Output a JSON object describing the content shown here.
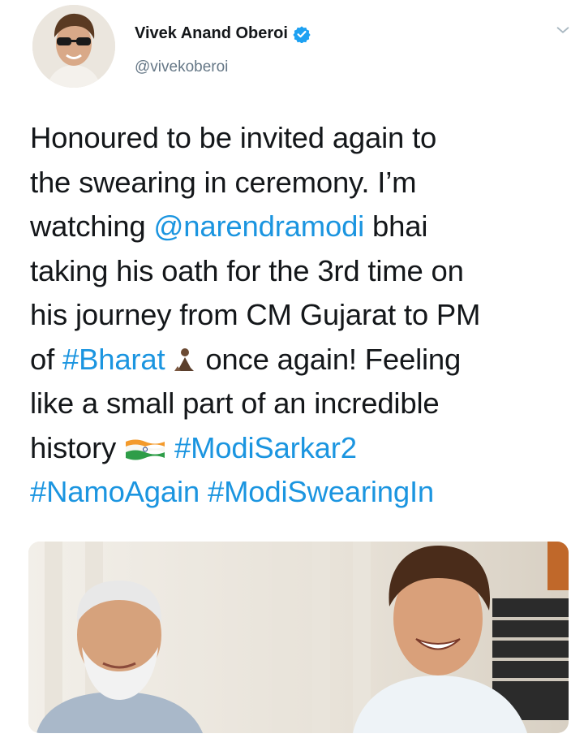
{
  "user": {
    "display_name": "Vivek Anand Oberoi",
    "handle": "@vivekoberoi"
  },
  "tweet": {
    "line1": "Honoured to be invited again to",
    "line2": "the swearing in ceremony. I’m",
    "line3_prefix": "watching ",
    "mention": "@narendramodi",
    "line3_suffix": " bhai",
    "line4": "taking his oath for the 3rd time on",
    "line5": "his journey from CM Gujarat to PM",
    "line6_prefix": "of ",
    "hashtag_bharat": "#Bharat",
    "line6_suffix": " once again! Feeling",
    "line7": "like a small part of an incredible",
    "line8_prefix": "history ",
    "hashtag_modisarkar2": "#ModiSarkar2",
    "hashtag_namoagain": "#NamoAgain",
    "hashtag_modiswearingin": "#ModiSwearingIn"
  },
  "icons": {
    "verified": "verified-badge-icon",
    "caret": "chevron-down-icon",
    "emoji_person": "person-in-lotus-position-emoji",
    "emoji_flag": "india-flag-emoji"
  },
  "colors": {
    "link": "#1b95e0",
    "text": "#14171a",
    "secondary": "#657786",
    "verified": "#1da1f2"
  }
}
